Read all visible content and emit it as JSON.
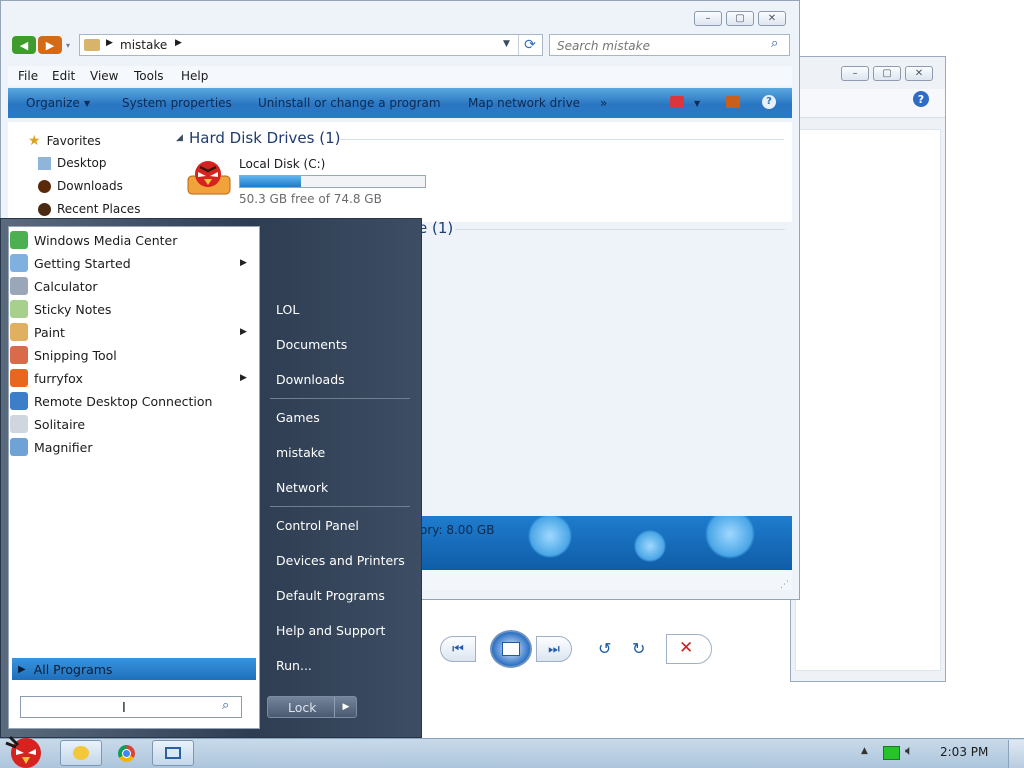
{
  "explorer": {
    "title_buttons": {
      "minimize": "▭",
      "maximize": "▣",
      "close": "✕"
    },
    "address": {
      "crumb": "mistake"
    },
    "search": {
      "placeholder": "Search mistake"
    },
    "menu": [
      "File",
      "Edit",
      "View",
      "Tools",
      "Help"
    ],
    "commands": [
      "Organize",
      "System properties",
      "Uninstall or change a program",
      "Map network drive",
      "»"
    ],
    "nav": {
      "favorites": "Favorites",
      "items": [
        "Desktop",
        "Downloads",
        "Recent Places"
      ]
    },
    "hard_disk_section": "Hard Disk Drives (1)",
    "drive": {
      "name": "Local Disk (C:)",
      "free_text": "50.3 GB free of 74.8 GB",
      "used_fraction": 0.33
    },
    "second_section_fragment": "e (1)",
    "details_fragment": "ory: 8.00 GB",
    "colors": {
      "command_bar": "#2a76c2",
      "accent": "#1e3c72"
    }
  },
  "start_menu": {
    "programs": [
      {
        "label": "Windows Media Center",
        "icon": "media-center-icon",
        "color": "#4caf50",
        "submenu": false
      },
      {
        "label": "Getting Started",
        "icon": "getting-started-icon",
        "color": "#7fb0e0",
        "submenu": true
      },
      {
        "label": "Calculator",
        "icon": "calculator-icon",
        "color": "#9aa7b8",
        "submenu": false
      },
      {
        "label": "Sticky Notes",
        "icon": "sticky-notes-icon",
        "color": "#a8d08d",
        "submenu": false
      },
      {
        "label": "Paint",
        "icon": "paint-icon",
        "color": "#e0b060",
        "submenu": true
      },
      {
        "label": "Snipping Tool",
        "icon": "snipping-tool-icon",
        "color": "#d96a4a",
        "submenu": false
      },
      {
        "label": "furryfox",
        "icon": "firefox-icon",
        "color": "#e8671e",
        "submenu": true
      },
      {
        "label": "Remote Desktop Connection",
        "icon": "remote-desktop-icon",
        "color": "#3c7fc8",
        "submenu": false
      },
      {
        "label": "Solitaire",
        "icon": "solitaire-icon",
        "color": "#cfd6de",
        "submenu": false
      },
      {
        "label": "Magnifier",
        "icon": "magnifier-icon",
        "color": "#6fa3d6",
        "submenu": false
      }
    ],
    "all_programs": "All Programs",
    "search_placeholder": "",
    "right_items": [
      {
        "label": "LOL",
        "group": 1
      },
      {
        "label": "Documents",
        "group": 1
      },
      {
        "label": "Downloads",
        "group": 1
      },
      {
        "label": "Games",
        "group": 2
      },
      {
        "label": "mistake",
        "group": 2
      },
      {
        "label": "Network",
        "group": 2
      },
      {
        "label": "Control Panel",
        "group": 3
      },
      {
        "label": "Devices and Printers",
        "group": 3
      },
      {
        "label": "Default Programs",
        "group": 3
      },
      {
        "label": "Help and Support",
        "group": 3
      },
      {
        "label": "Run...",
        "group": 3
      }
    ],
    "lock_label": "Lock"
  },
  "taskbar": {
    "clock": "2:03 PM",
    "pinned": [
      "explorer-icon",
      "chrome-icon",
      "photo-viewer-icon"
    ]
  }
}
